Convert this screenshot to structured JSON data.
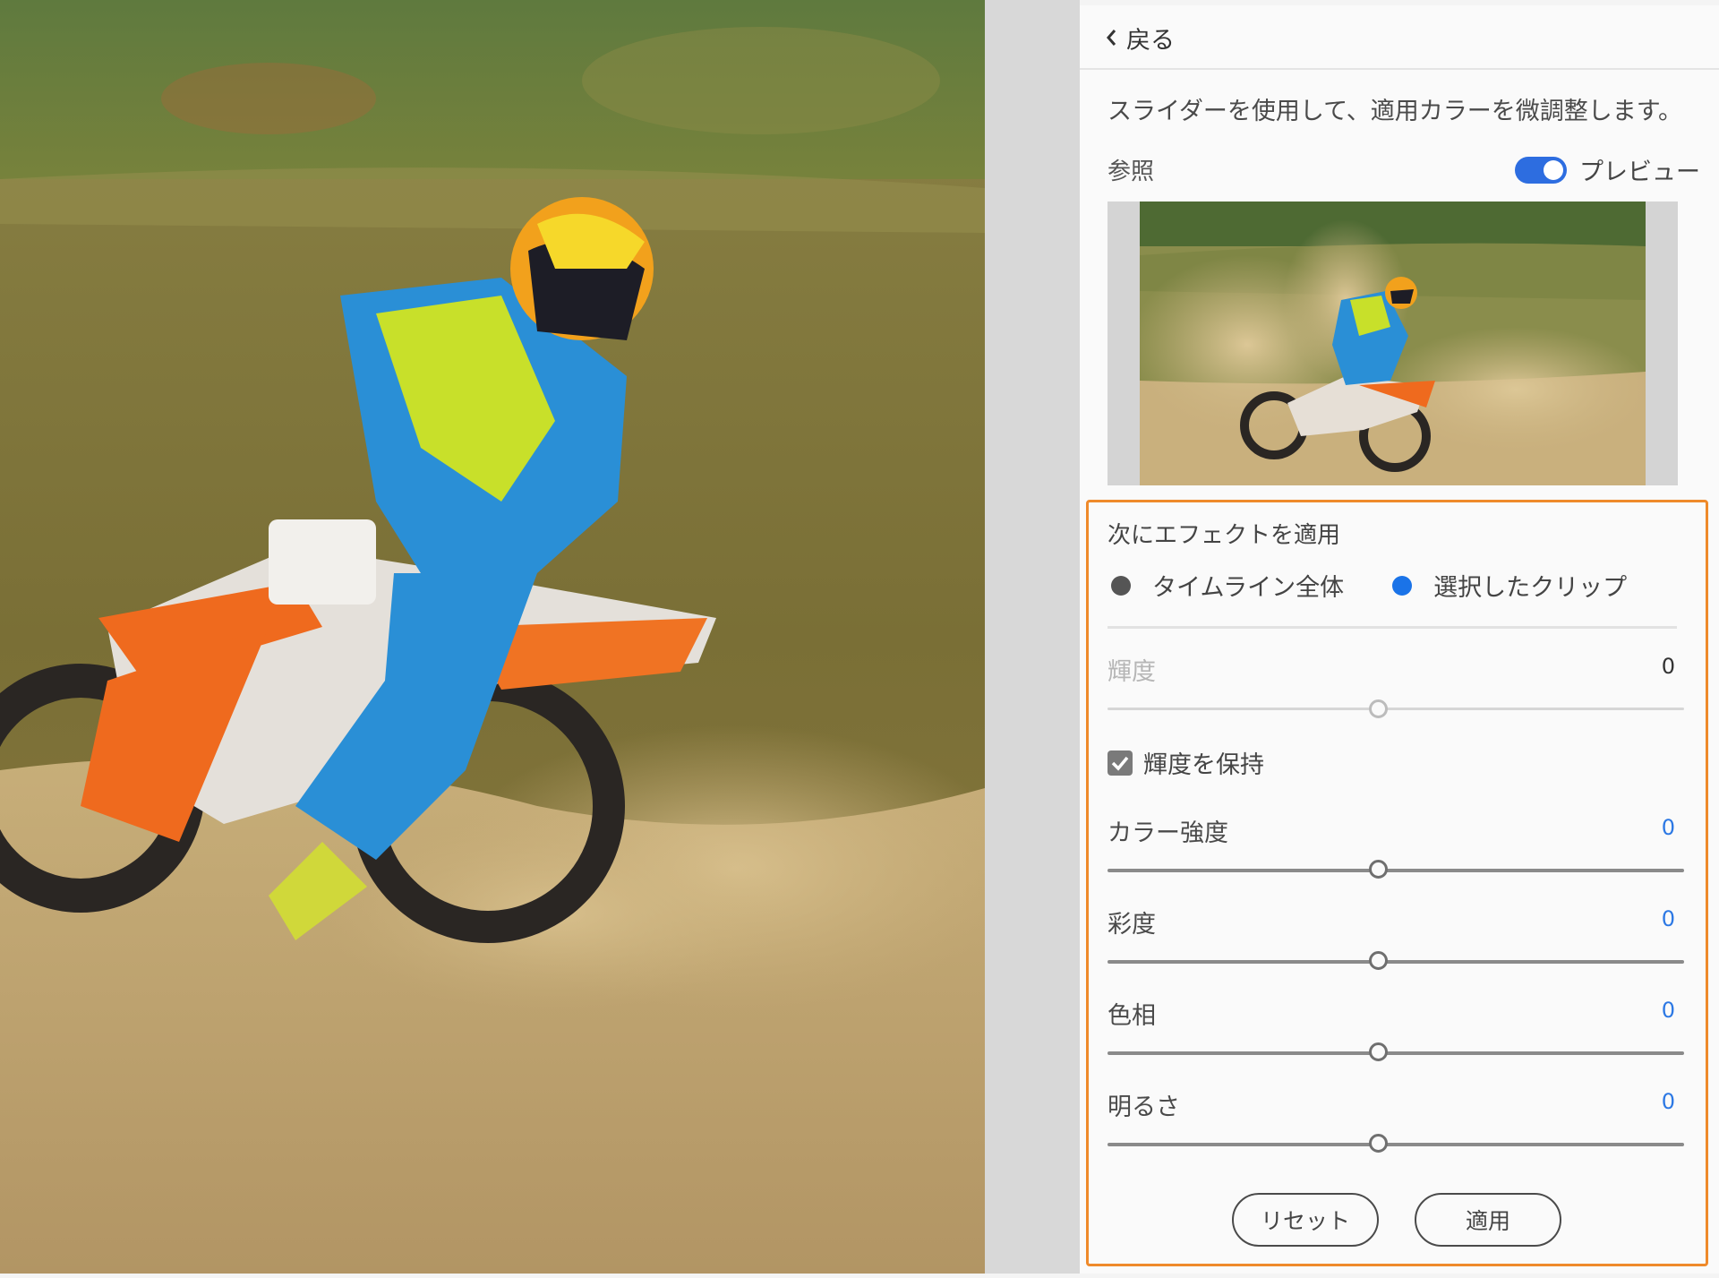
{
  "panel": {
    "back_label": "戻る",
    "hint": "スライダーを使用して、適用カラーを微調整します。",
    "reference_label": "参照",
    "preview_label": "プレビュー",
    "preview_on": true
  },
  "apply_to": {
    "title": "次にエフェクトを適用",
    "options": [
      "タイムライン全体",
      "選択したクリップ"
    ],
    "selected": "選択したクリップ"
  },
  "luminance": {
    "label": "輝度",
    "value": "0",
    "enabled": false,
    "level": 0.5
  },
  "preserve_luminance": {
    "label": "輝度を保持",
    "checked": true
  },
  "sliders": [
    {
      "label": "カラー強度",
      "value": "0",
      "level": 0.5
    },
    {
      "label": "彩度",
      "value": "0",
      "level": 0.5
    },
    {
      "label": "色相",
      "value": "0",
      "level": 0.5
    },
    {
      "label": "明るさ",
      "value": "0",
      "level": 0.5
    }
  ],
  "buttons": {
    "reset": "リセット",
    "apply": "適用"
  },
  "colors": {
    "accent": "#1a73e8",
    "highlight_border": "#ef8a2b",
    "toggle": "#2d6de0"
  }
}
